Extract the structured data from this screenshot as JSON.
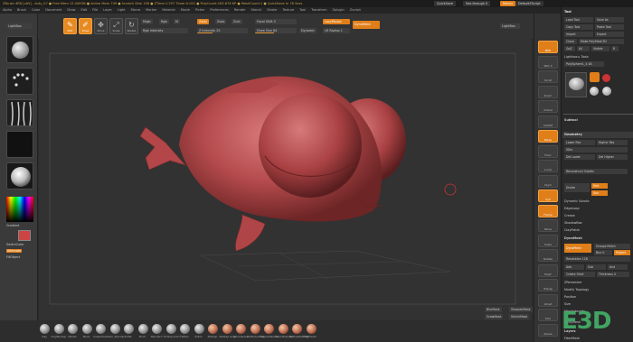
{
  "titlebar": {
    "text": "ZBrush 4R6 [vb5]  -  duty_07  ●  Free Mem 12.049GB ● Active Mem 749 ● Scratch Disk 156 ● ZTime:1.297 Timer:0.001 ● PolyCount:165.876 KP ● MeshCount:1  ●  QuickSave In 78 Secs",
    "quicksave": "QuickSave",
    "seethrough": "See-through  0",
    "menus": "Menus",
    "defaultscript": "DefaultZScript"
  },
  "menubar": [
    "Alpha",
    "Brush",
    "Color",
    "Document",
    "Draw",
    "Edit",
    "File",
    "Layer",
    "Light",
    "Macro",
    "Marker",
    "Material",
    "Movie",
    "Picker",
    "Preferences",
    "Render",
    "Stencil",
    "Stroke",
    "Texture",
    "Tool",
    "Transform",
    "Zplugin",
    "Zscript"
  ],
  "toolbar": {
    "edit": "Edit",
    "draw": "Draw",
    "move": "Move",
    "scale": "Scale",
    "rotate": "Rotate",
    "mrgb": "Mrgb",
    "rgb": "Rgb",
    "m": "M",
    "rgb_intensity": "Rgb Intensity",
    "zadd": "Zadd",
    "zsub": "Zsub",
    "zcut": "Zcut",
    "z_intensity": "Z Intensity 25",
    "focal_shift": "Focal Shift 0",
    "draw_size": "Draw Size 64",
    "dynamic": "Dynamic",
    "lazymouse": "LazyMouse",
    "lazyradius": "LR Radius 1",
    "dynamesh": "DynaMesh",
    "lightbox": "LightBox"
  },
  "lefttray": {
    "texture_off": "Texture Off",
    "alpha_off": "Alpha Off",
    "gradient": "Gradient",
    "switchcolor": "SwitchColor",
    "alternate": "Alternate",
    "fillobject": "FillObject"
  },
  "bottomshelf": {
    "brushes": [
      "Clay",
      "ClayBuildup",
      "hPolish",
      "Move",
      "SnakeHook",
      "Dam_Standard",
      "Inflat",
      "Pinch",
      "Standard",
      "TrimDynamic",
      "Flatten",
      "Polish",
      "MatCap",
      "MatCap Gray",
      "SkinShade4",
      "ReflectedMap",
      "BasicMaterial",
      "BasicMaterial2",
      "NormalRGBMat",
      "ToyPlastic"
    ],
    "bottom_buttons": [
      "BlurMask",
      "SharpenMask",
      "GrowMask",
      "ShrinkMask"
    ]
  },
  "righttray": [
    "BPR",
    "SPix 3",
    "Scroll",
    "Zoom",
    "Actual",
    "AAHalf",
    "Persp",
    "Floor",
    "Local",
    "LSym",
    "Xyz",
    "Frame",
    "Move",
    "Scale",
    "Rotate",
    "PolyF",
    "Transp",
    "Ghost",
    "Solo",
    "Xpose"
  ],
  "panel": {
    "tool_title": "Tool",
    "rows": [
      [
        "Load Tool",
        "Save As"
      ],
      [
        "Copy Tool",
        "Paste Tool"
      ],
      [
        "Import",
        "Export"
      ],
      [
        "Clone",
        "Make PolyMesh3D"
      ],
      [
        "GoZ",
        "All",
        "Visible",
        "R"
      ]
    ],
    "lightbox_tools": "Lightbox ▸ Tools",
    "polysphere": "PolySphere1_4  48",
    "subtool": "Subtool",
    "geometry": "Geometry",
    "lower_res": "Lower Res",
    "higher_res": "Higher Res",
    "sdiv": "SDiv",
    "del_lower": "Del Lower",
    "del_higher": "Del Higher",
    "reconstruct": "Reconstruct Subdiv",
    "divide": "Divide",
    "smt": "Smt",
    "suv": "Suv",
    "dynamic_subdiv": "Dynamic Subdiv",
    "edgeloop": "EdgeLoop",
    "crease": "Crease",
    "shadowbox": "ShadowBox",
    "claypolish": "ClayPolish",
    "dynamesh_sect": "DynaMesh",
    "dynamesh_btn": "DynaMesh",
    "groups_polish": "Groups  Polish",
    "blur": "Blur 0",
    "project": "Project",
    "resolution": "Resolution 128",
    "add": "Add",
    "sub": "Sub",
    "and": "And",
    "create_shell": "Create Shell",
    "thickness": "Thickness 4",
    "zremesher": "ZRemesher",
    "modify_topology": "Modify Topology",
    "position": "Position",
    "size": "Size",
    "meshintegrity": "MeshIntegrity",
    "array_mesh": "ArrayMesh",
    "layers": "Layers",
    "fibermesh": "FiberMesh"
  },
  "watermark": "E3D",
  "colors": {
    "accent": "#e07f1a",
    "model": "#b84a4c",
    "bg": "#2b2b2b"
  }
}
